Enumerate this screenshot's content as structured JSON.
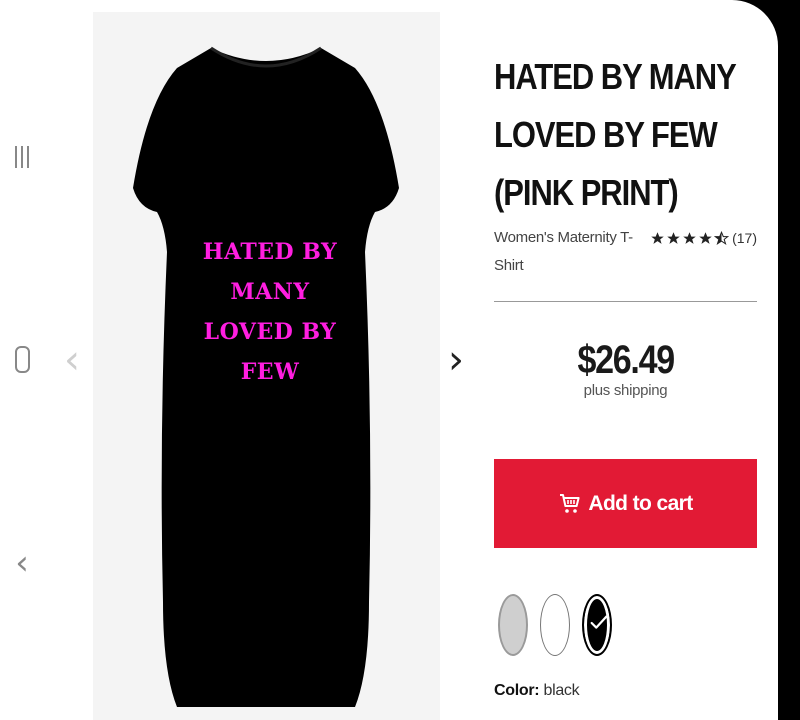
{
  "product": {
    "title": "HATED BY MANY LOVED BY FEW (PINK PRINT)",
    "type": "Women's Maternity T-Shirt",
    "rating_stars": 4.5,
    "review_count": "(17)",
    "price": "$26.49",
    "shipping": "plus shipping",
    "add_to_cart": "Add to cart",
    "color_label": "Color:",
    "color_value": "black",
    "print_lines": [
      "HATED BY",
      "MANY",
      "LOVED BY",
      "FEW"
    ],
    "colors": [
      {
        "name": "grey",
        "hex": "#cfcfcf"
      },
      {
        "name": "white",
        "hex": "#ffffff"
      },
      {
        "name": "black",
        "hex": "#000000",
        "selected": true
      }
    ]
  },
  "icons": {
    "recents": "recents-icon",
    "home": "home-icon",
    "back": "back-icon",
    "prev": "chevron-left-icon",
    "next": "chevron-right-icon",
    "cart": "shopping-cart-icon",
    "check": "checkmark-icon",
    "star": "star-icon"
  },
  "colors": {
    "accent": "#e21a35",
    "print": "#ff1ee0",
    "shirt": "#000000"
  }
}
